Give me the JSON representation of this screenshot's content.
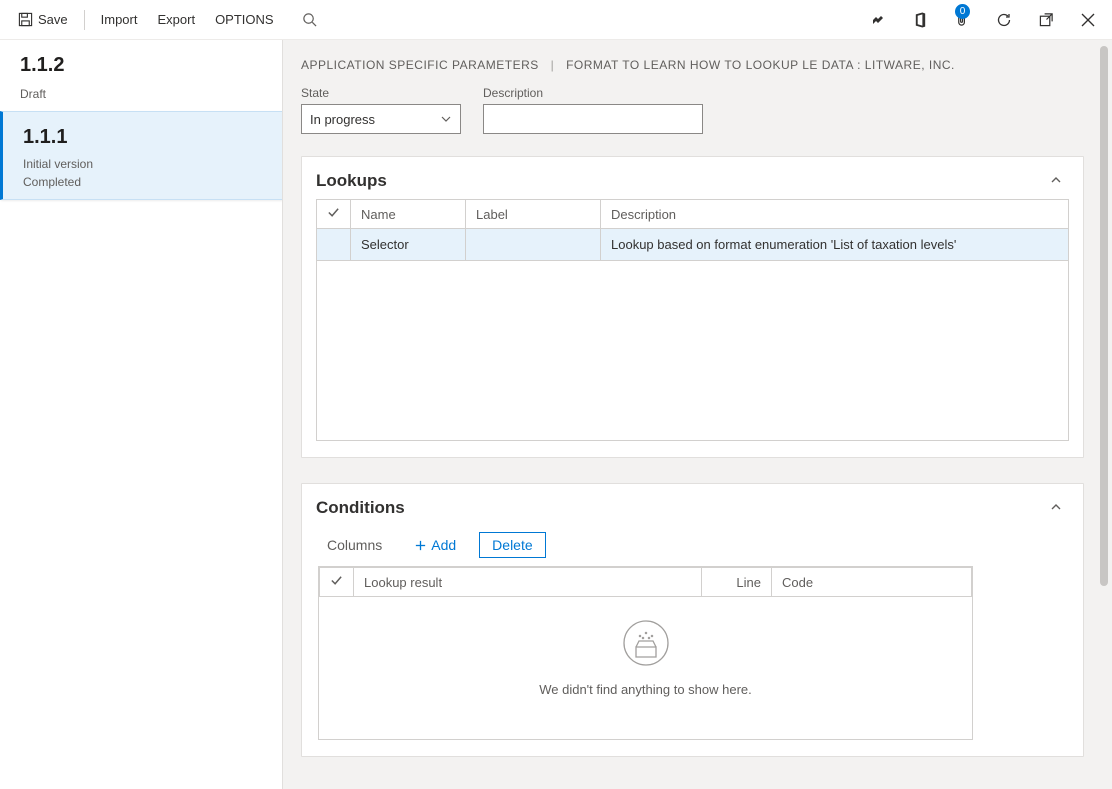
{
  "topbar": {
    "save_label": "Save",
    "import_label": "Import",
    "export_label": "Export",
    "options_label": "OPTIONS",
    "badge_count": "0"
  },
  "sidebar": {
    "items": [
      {
        "title": "1.1.2",
        "sub1": "Draft"
      },
      {
        "title": "1.1.1",
        "sub1": "Initial version",
        "sub2": "Completed"
      }
    ]
  },
  "breadcrumb": {
    "part1": "Application specific parameters",
    "part2": "Format to learn how to lookup LE data : Litware, Inc."
  },
  "fields": {
    "state_label": "State",
    "state_value": "In progress",
    "description_label": "Description",
    "description_value": ""
  },
  "lookups": {
    "title": "Lookups",
    "columns": {
      "name": "Name",
      "label": "Label",
      "description": "Description"
    },
    "rows": [
      {
        "name": "Selector",
        "label": "",
        "description": "Lookup based on format enumeration 'List of taxation levels'"
      }
    ]
  },
  "conditions": {
    "title": "Conditions",
    "toolbar": {
      "columns_label": "Columns",
      "add_label": "Add",
      "delete_label": "Delete"
    },
    "columns": {
      "result": "Lookup result",
      "line": "Line",
      "code": "Code"
    },
    "empty_text": "We didn't find anything to show here."
  }
}
